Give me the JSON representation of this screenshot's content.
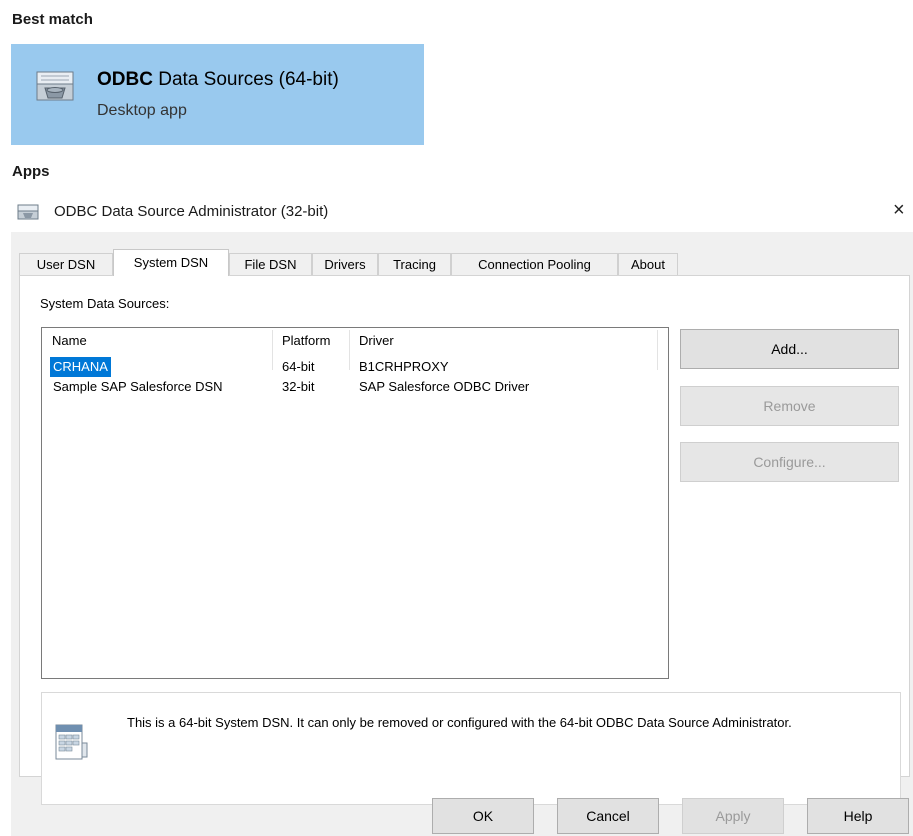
{
  "search": {
    "best_match_heading": "Best match",
    "best_match": {
      "title_bold": "ODBC",
      "title_rest": " Data Sources (64-bit)",
      "subtitle": "Desktop app",
      "icon": "odbc-admin-icon"
    },
    "apps_heading": "Apps",
    "apps": [
      {
        "label": "ODBC Data Source Administrator (32-bit)",
        "icon": "odbc-admin-icon",
        "close_glyph": "×"
      }
    ]
  },
  "dialog": {
    "tabs": [
      "User DSN",
      "System DSN",
      "File DSN",
      "Drivers",
      "Tracing",
      "Connection Pooling",
      "About"
    ],
    "active_tab": "System DSN",
    "list_label": "System Data Sources:",
    "columns": [
      "Name",
      "Platform",
      "Driver"
    ],
    "rows": [
      {
        "name": "CRHANA",
        "platform": "64-bit",
        "driver": "B1CRHPROXY",
        "selected": true
      },
      {
        "name": "Sample SAP Salesforce DSN",
        "platform": "32-bit",
        "driver": "SAP Salesforce ODBC Driver",
        "selected": false
      }
    ],
    "side_buttons": {
      "add": "Add...",
      "remove": "Remove",
      "configure": "Configure..."
    },
    "info_message": "This is a 64-bit System DSN. It can only be removed or configured with the 64-bit ODBC Data Source Administrator.",
    "footer_buttons": {
      "ok": "OK",
      "cancel": "Cancel",
      "apply": "Apply",
      "help": "Help"
    }
  },
  "colors": {
    "best_match_bg": "#99c9ee",
    "selection": "#0078d7",
    "dialog_bg": "#f0f0f0"
  }
}
